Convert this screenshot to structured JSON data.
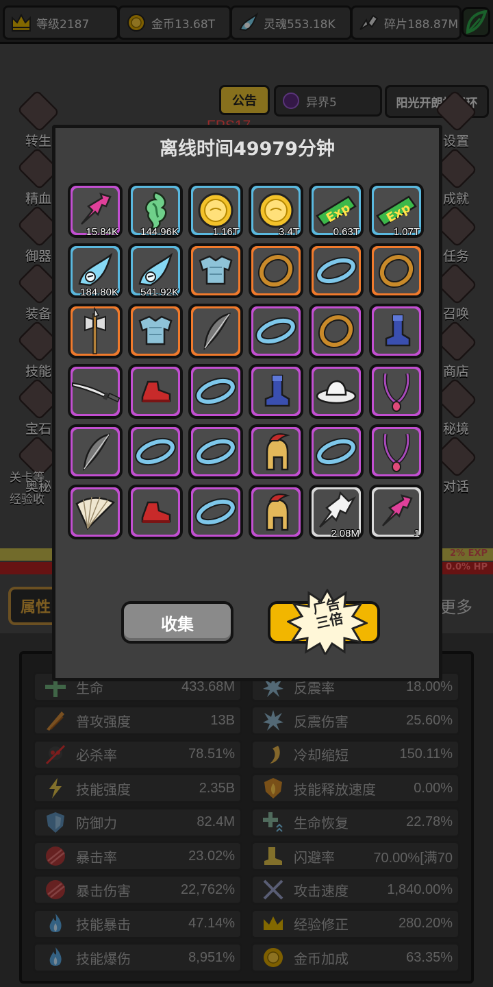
{
  "topbar": {
    "level": "等级2187",
    "gold": "金币13.68T",
    "soul": "灵魂553.18K",
    "shard": "碎片188.87M"
  },
  "scene": {
    "notice_label": "公告",
    "world_label": "异界5",
    "player_name": "阳光开朗杨玉环",
    "fps": "FPS17",
    "left_menu": [
      "转生",
      "精血",
      "御器",
      "装备",
      "技能",
      "宝石",
      "奥秘"
    ],
    "right_menu": [
      "设置",
      "成就",
      "任务",
      "召唤",
      "商店",
      "秘境",
      "对话"
    ],
    "stage_text": "关卡等",
    "exp_text": "经验收",
    "exp_bar": "2% EXP",
    "hp_bar": "0.0% HP",
    "attr_tab": "属性",
    "more_tab": "更多"
  },
  "modal": {
    "title": "离线时间49979分钟",
    "collect_label": "收集",
    "ad_label_line1": "广告",
    "ad_label_line2": "三倍"
  },
  "rewards": [
    {
      "quality": "purple",
      "icon": "pink-dash-icon",
      "qty": "15.84K"
    },
    {
      "quality": "blue",
      "icon": "green-soul-icon",
      "qty": "144.96K"
    },
    {
      "quality": "blue",
      "icon": "gold-coin-icon",
      "qty": "1.16T"
    },
    {
      "quality": "blue",
      "icon": "gold-coin-icon",
      "qty": "3.4T"
    },
    {
      "quality": "blue",
      "icon": "exp-ticket-icon",
      "qty": "0.63T"
    },
    {
      "quality": "blue",
      "icon": "exp-ticket-icon",
      "qty": "1.07T"
    },
    {
      "quality": "blue",
      "icon": "soul-flame-icon",
      "qty": "184.80K"
    },
    {
      "quality": "blue",
      "icon": "soul-flame-icon",
      "qty": "541.92K"
    },
    {
      "quality": "orange",
      "icon": "armor-icon",
      "qty": ""
    },
    {
      "quality": "orange",
      "icon": "bracelet-icon",
      "qty": ""
    },
    {
      "quality": "orange",
      "icon": "blue-bracelet-icon",
      "qty": ""
    },
    {
      "quality": "orange",
      "icon": "bracelet-icon",
      "qty": ""
    },
    {
      "quality": "orange",
      "icon": "halberd-icon",
      "qty": ""
    },
    {
      "quality": "orange",
      "icon": "armor-icon",
      "qty": ""
    },
    {
      "quality": "orange",
      "icon": "bow-icon",
      "qty": ""
    },
    {
      "quality": "purple",
      "icon": "blue-bracelet-icon",
      "qty": ""
    },
    {
      "quality": "purple",
      "icon": "bracelet-icon",
      "qty": ""
    },
    {
      "quality": "purple",
      "icon": "boot-icon",
      "qty": ""
    },
    {
      "quality": "purple",
      "icon": "katana-icon",
      "qty": ""
    },
    {
      "quality": "purple",
      "icon": "red-shoe-icon",
      "qty": ""
    },
    {
      "quality": "purple",
      "icon": "blue-bracelet-icon",
      "qty": ""
    },
    {
      "quality": "purple",
      "icon": "boot-icon",
      "qty": ""
    },
    {
      "quality": "purple",
      "icon": "straw-hat-icon",
      "qty": ""
    },
    {
      "quality": "purple",
      "icon": "necklace-icon",
      "qty": ""
    },
    {
      "quality": "purple",
      "icon": "bow-icon",
      "qty": ""
    },
    {
      "quality": "purple",
      "icon": "blue-bracelet-icon",
      "qty": ""
    },
    {
      "quality": "purple",
      "icon": "blue-bracelet-icon",
      "qty": ""
    },
    {
      "quality": "purple",
      "icon": "helmet-icon",
      "qty": ""
    },
    {
      "quality": "purple",
      "icon": "blue-bracelet-icon",
      "qty": ""
    },
    {
      "quality": "purple",
      "icon": "necklace-icon",
      "qty": ""
    },
    {
      "quality": "purple",
      "icon": "fan-icon",
      "qty": ""
    },
    {
      "quality": "purple",
      "icon": "red-shoe-icon",
      "qty": ""
    },
    {
      "quality": "purple",
      "icon": "blue-bracelet-icon",
      "qty": ""
    },
    {
      "quality": "purple",
      "icon": "helmet-icon",
      "qty": ""
    },
    {
      "quality": "white",
      "icon": "grey-dash-icon",
      "qty": "2.08M"
    },
    {
      "quality": "white",
      "icon": "pink-dash-icon",
      "qty": "1"
    }
  ],
  "colors": {
    "purple": "#c24fd1",
    "blue": "#5ab8de",
    "orange": "#f07a2c",
    "white": "#d9d9d9",
    "ad_button": "#f2b600",
    "collect_button": "#8a8a8a"
  },
  "stats": [
    {
      "name": "生命",
      "value": "433.68M",
      "icon": "cross-icon"
    },
    {
      "name": "反震率",
      "value": "18.00%",
      "icon": "shatter-icon"
    },
    {
      "name": "普攻强度",
      "value": "13B",
      "icon": "claw-icon"
    },
    {
      "name": "反震伤害",
      "value": "25.60%",
      "icon": "shatter-icon"
    },
    {
      "name": "必杀率",
      "value": "78.51%",
      "icon": "skull-icon"
    },
    {
      "name": "冷却缩短",
      "value": "150.11%",
      "icon": "cooldown-icon"
    },
    {
      "name": "技能强度",
      "value": "2.35B",
      "icon": "lightning-icon"
    },
    {
      "name": "技能释放速度",
      "value": "0.00%",
      "icon": "fire-shield-icon"
    },
    {
      "name": "防御力",
      "value": "82.4M",
      "icon": "shield-icon"
    },
    {
      "name": "生命恢复",
      "value": "22.78%",
      "icon": "regen-icon"
    },
    {
      "name": "暴击率",
      "value": "23.02%",
      "icon": "crit-icon"
    },
    {
      "name": "闪避率",
      "value": "70.00%[满70",
      "icon": "boot-icon"
    },
    {
      "name": "暴击伤害",
      "value": "22,762%",
      "icon": "crit-icon"
    },
    {
      "name": "攻击速度",
      "value": "1,840.00%",
      "icon": "swords-icon"
    },
    {
      "name": "技能暴击",
      "value": "47.14%",
      "icon": "blue-flame-icon"
    },
    {
      "name": "经验修正",
      "value": "280.20%",
      "icon": "crown-icon"
    },
    {
      "name": "技能爆伤",
      "value": "8,951%",
      "icon": "blue-flame-icon"
    },
    {
      "name": "金币加成",
      "value": "63.35%",
      "icon": "gold-coin-icon"
    }
  ]
}
